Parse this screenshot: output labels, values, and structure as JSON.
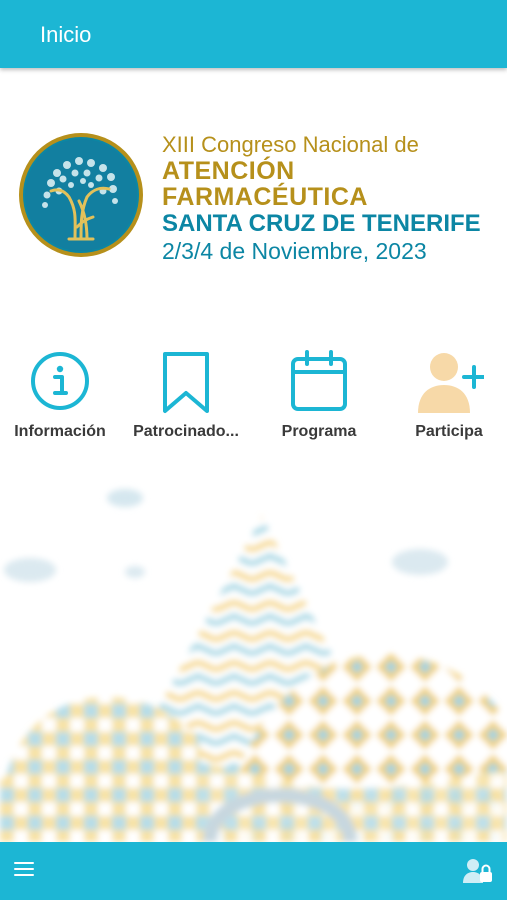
{
  "header": {
    "title": "Inicio"
  },
  "banner": {
    "line1": "XIII Congreso Nacional de",
    "line2": "ATENCIÓN",
    "line3": "FARMACÉUTICA",
    "line4": "SANTA CRUZ DE TENERIFE",
    "line5": "2/3/4 de Noviembre, 2023"
  },
  "menu": {
    "items": [
      {
        "label": "Información",
        "icon": "info-icon"
      },
      {
        "label": "Patrocinado...",
        "icon": "bookmark-icon"
      },
      {
        "label": "Programa",
        "icon": "calendar-icon"
      },
      {
        "label": "Participa",
        "icon": "user-add-icon"
      }
    ]
  },
  "colors": {
    "primary": "#1cb6d4",
    "gold": "#b6901b",
    "teal": "#0c86a4",
    "participa_accent": "#f7d9a8"
  },
  "bottom_bar": {
    "menu_icon": "hamburger-menu-icon",
    "account_icon": "user-lock-icon"
  }
}
